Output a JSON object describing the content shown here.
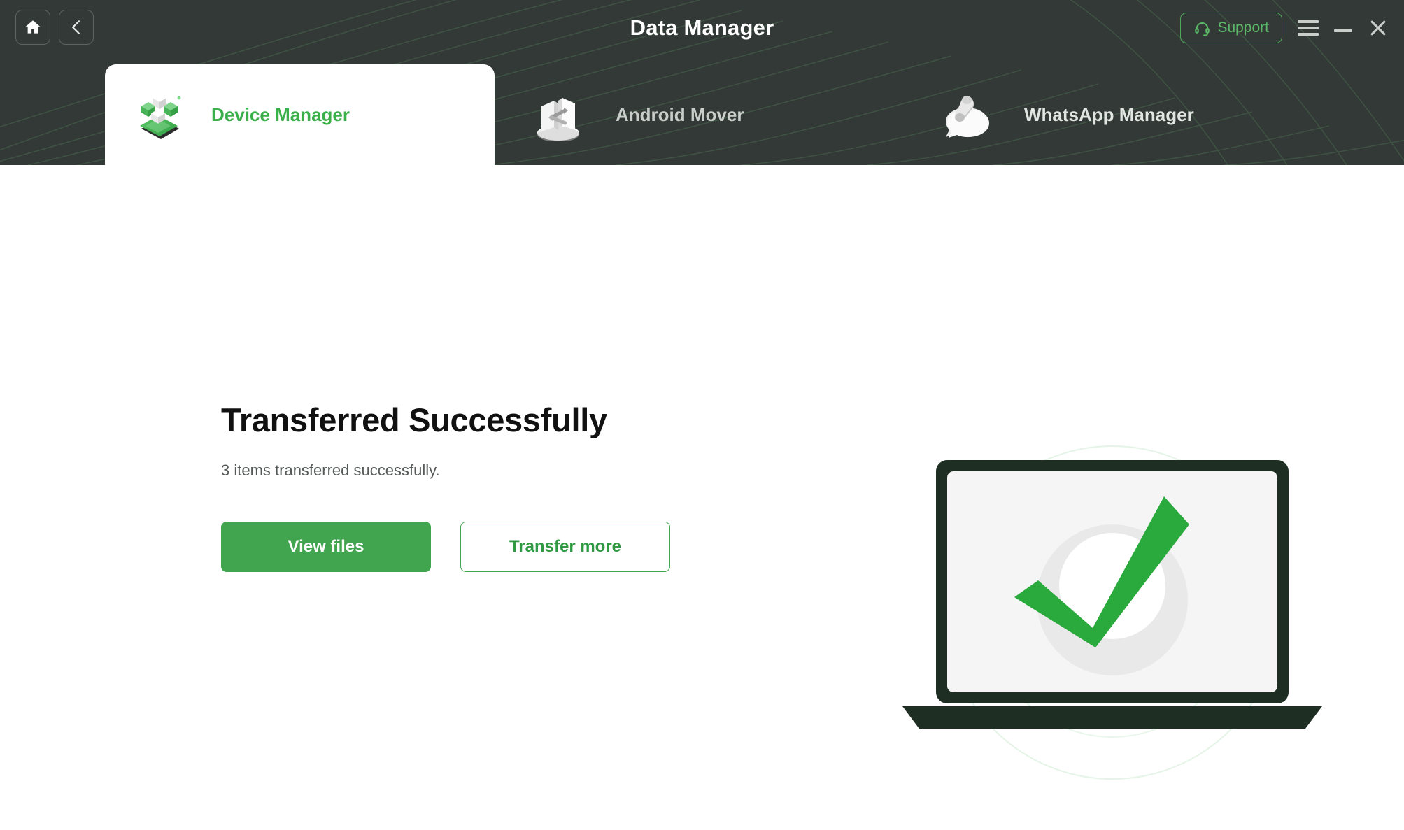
{
  "window": {
    "title": "Data Manager",
    "accent_green": "#41a44e",
    "header_bg": "#333936",
    "nav": {
      "home_label": "Home",
      "home_icon": "home-icon",
      "back_label": "Back",
      "back_icon": "chevron-left-icon"
    },
    "controls": {
      "support_label": "Support",
      "support_icon": "headset-icon",
      "menu_icon": "hamburger-menu-icon",
      "minimize_icon": "minimize-icon",
      "close_icon": "close-icon"
    }
  },
  "tabs": [
    {
      "label": "Device Manager",
      "icon": "device-manager-icon",
      "active": true
    },
    {
      "label": "Android Mover",
      "icon": "android-mover-icon",
      "active": false
    },
    {
      "label": "WhatsApp Manager",
      "icon": "whatsapp-manager-icon",
      "active": false
    }
  ],
  "main": {
    "headline": "Transferred Successfully",
    "subline": "3 items transferred successfully.",
    "items_transferred": 3,
    "primary_button": "View files",
    "secondary_button": "Transfer more",
    "illustration": "laptop-success-checkmark-illustration"
  }
}
